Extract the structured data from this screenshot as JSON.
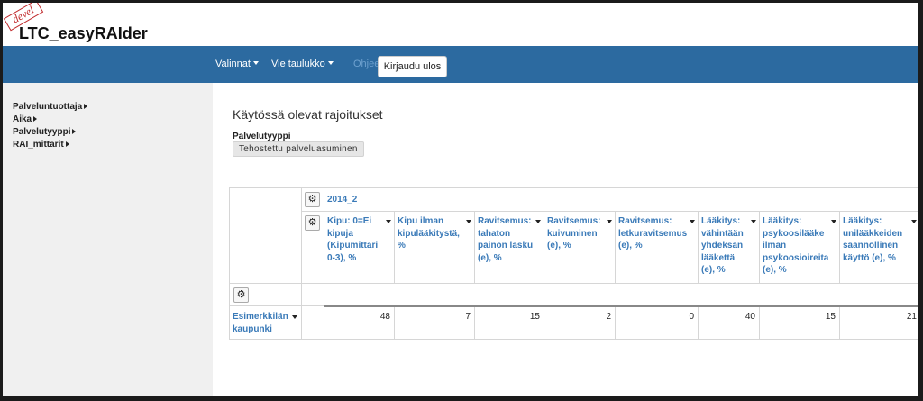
{
  "header": {
    "brand": "LTC_easyRAIder",
    "stamp": "devel"
  },
  "nav": {
    "items": [
      {
        "label": "Valinnat"
      },
      {
        "label": "Vie taulukko"
      }
    ],
    "help_label": "Ohjeet",
    "logout_label": "Kirjaudu ulos"
  },
  "sidebar": {
    "items": [
      {
        "label": "Palveluntuottaja"
      },
      {
        "label": "Aika"
      },
      {
        "label": "Palvelutyyppi"
      },
      {
        "label": "RAI_mittarit"
      }
    ]
  },
  "main": {
    "title": "Käytössä olevat rajoitukset",
    "filter_label": "Palvelutyyppi",
    "filter_value": "Tehostettu palveluasuminen"
  },
  "pivot": {
    "period": "2014_2",
    "gear_icon": "gear-icon",
    "columns": [
      {
        "label": "Kipu: 0=Ei kipuja (Kipumittari 0-3), %"
      },
      {
        "label": "Kipu ilman kipulääkitystä, %"
      },
      {
        "label": "Ravitsemus: tahaton painon lasku (e), %"
      },
      {
        "label": "Ravitsemus: kuivuminen (e), %"
      },
      {
        "label": "Ravitsemus: letkuravitsemus (e), %"
      },
      {
        "label": "Lääkitys: vähintään yhdeksän lääkettä (e), %"
      },
      {
        "label": "Lääkitys: psykoosilääke ilman psykoosioireita (e), %"
      },
      {
        "label": "Lääkitys: unilääkkeiden säännöllinen käyttö (e), %"
      }
    ],
    "rows": [
      {
        "label": "Esimerkkilän kaupunki",
        "values": [
          "48",
          "7",
          "15",
          "2",
          "0",
          "40",
          "15",
          "21"
        ]
      }
    ]
  }
}
